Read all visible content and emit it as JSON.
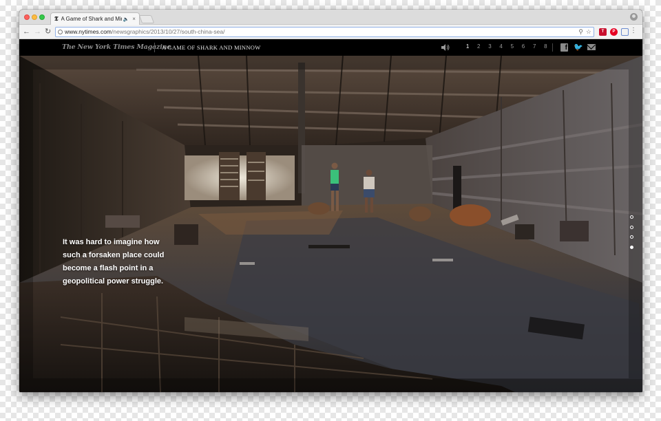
{
  "browser": {
    "tab": {
      "favicon": "𝕿",
      "title": "A Game of Shark and Minn",
      "speaker_icon": "speaker-icon",
      "close_icon": "close-icon"
    },
    "url": {
      "host": "www.nytimes.com",
      "path": "/newsgraphics/2013/10/27/south-china-sea/"
    },
    "extensions": [
      "nyt-extension-icon",
      "pinterest-icon",
      "cast-icon"
    ],
    "nav_icons": {
      "back": "←",
      "forward": "→",
      "reload": "↻"
    }
  },
  "header": {
    "masthead": "The New York Times Magazine",
    "story_title": "A GAME OF SHARK AND MINNOW",
    "chapters": [
      "1",
      "2",
      "3",
      "4",
      "5",
      "6",
      "7",
      "8"
    ],
    "active_chapter": "1",
    "social_icons": [
      "facebook-icon",
      "twitter-icon",
      "email-icon"
    ]
  },
  "hero": {
    "caption": "It was hard to imagine how such a forsaken place could become a flash point in a geopolitical power struggle.",
    "section_dots_count": 4,
    "active_section_dot": 4
  },
  "colors": {
    "page_bg": "#000000",
    "masthead": "#8c8c8c",
    "caption": "#ffffff"
  }
}
